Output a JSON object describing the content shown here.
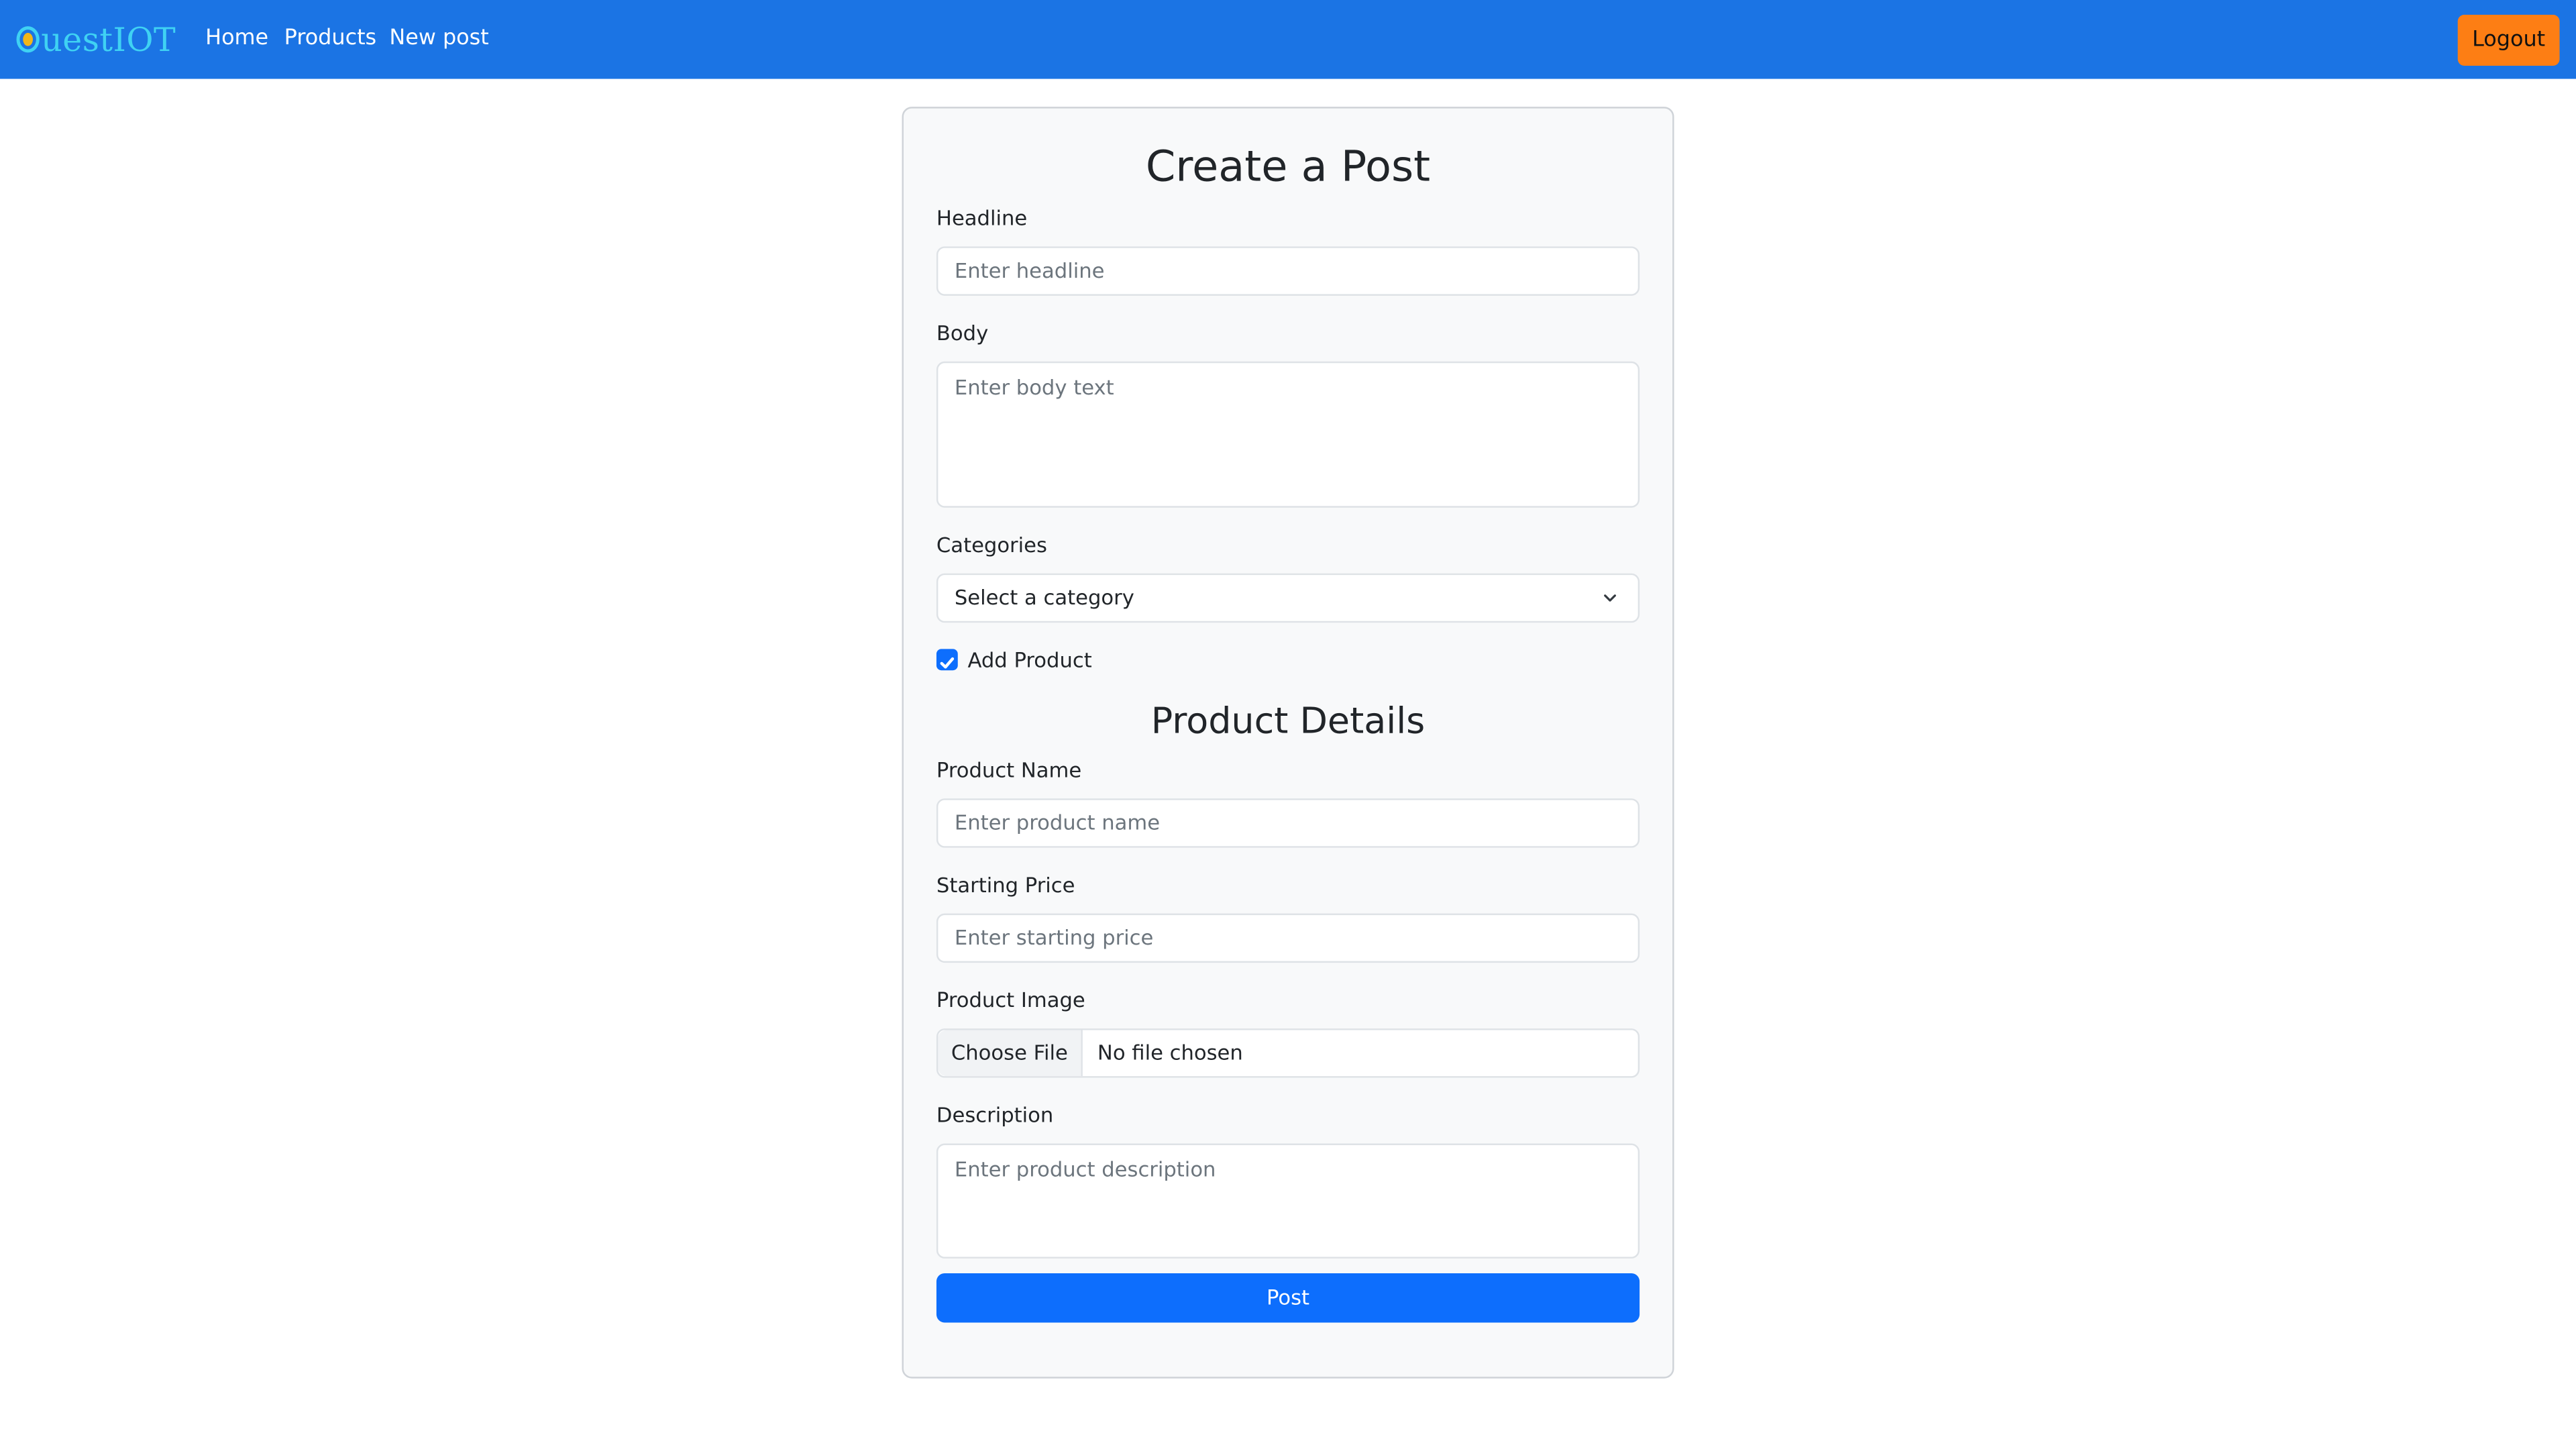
{
  "nav": {
    "brand": "QuestIOT",
    "brand_text": "uestIOT",
    "links": [
      "Home",
      "Products",
      "New post"
    ],
    "logout": "Logout"
  },
  "form": {
    "title": "Create a Post",
    "headline_label": "Headline",
    "headline_placeholder": "Enter headline",
    "body_label": "Body",
    "body_placeholder": "Enter body text",
    "categories_label": "Categories",
    "category_selected": "Select a category",
    "add_product_label": "Add Product",
    "add_product_checked": true,
    "product_section_title": "Product Details",
    "product_name_label": "Product Name",
    "product_name_placeholder": "Enter product name",
    "starting_price_label": "Starting Price",
    "starting_price_placeholder": "Enter starting price",
    "product_image_label": "Product Image",
    "choose_file_label": "Choose File",
    "no_file_text": "No file chosen",
    "description_label": "Description",
    "description_placeholder": "Enter product description",
    "post_button": "Post"
  },
  "colors": {
    "navbar": "#1b74e4",
    "brand": "#3fd2f3",
    "logout": "#fd7e14",
    "primary": "#0d6efd",
    "card": "#f8f9fa"
  },
  "icons": {
    "brand_logo": "brand-logo-icon",
    "select_chevron": "chevron-down-icon",
    "checkbox": "check-icon"
  }
}
